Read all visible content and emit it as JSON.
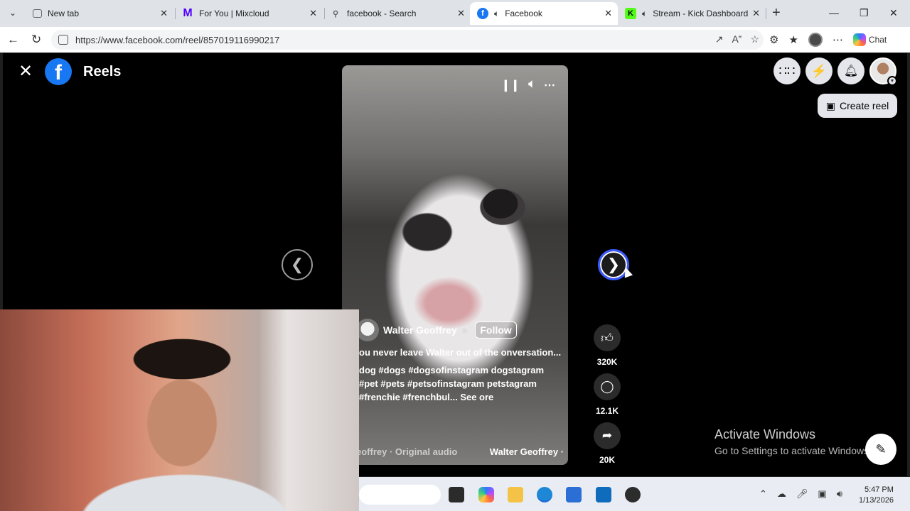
{
  "browser": {
    "tabs": [
      {
        "title": "New tab",
        "icon": "new-tab-page-icon",
        "active": false,
        "audio": false
      },
      {
        "title": "For You | Mixcloud",
        "icon": "mixcloud-icon",
        "active": false,
        "audio": false
      },
      {
        "title": "facebook - Search",
        "icon": "search-icon",
        "active": false,
        "audio": false
      },
      {
        "title": "Facebook",
        "icon": "facebook-icon",
        "active": true,
        "audio": true
      },
      {
        "title": "Stream - Kick Dashboard",
        "icon": "kick-icon",
        "active": false,
        "audio": true
      }
    ],
    "url": "https://www.facebook.com/reel/857019116990217",
    "chat_label": "Chat"
  },
  "reels": {
    "title": "Reels",
    "create_reel_label": "Create reel",
    "video": {
      "author": "Walter Geoffrey",
      "follow_label": "Follow",
      "caption": "ou never leave Walter out of the onversation...",
      "hashtags": "dog #dogs #dogsofinstagram dogstagram #pet #pets #petsofinstagram petstagram #frenchie #frenchbul... See ore",
      "audio_left": "eoffrey · Original audio",
      "audio_right": "Walter Geoffrey ·"
    },
    "actions": {
      "likes": "320K",
      "comments": "12.1K",
      "shares": "20K"
    }
  },
  "windows": {
    "activate_title": "Activate Windows",
    "activate_sub": "Go to Settings to activate Windows.",
    "time": "5:47 PM",
    "date": "1/13/2026"
  },
  "colors": {
    "facebook_blue": "#1877f2",
    "mixcloud_purple": "#5000ff",
    "kick_green": "#53fc18"
  }
}
